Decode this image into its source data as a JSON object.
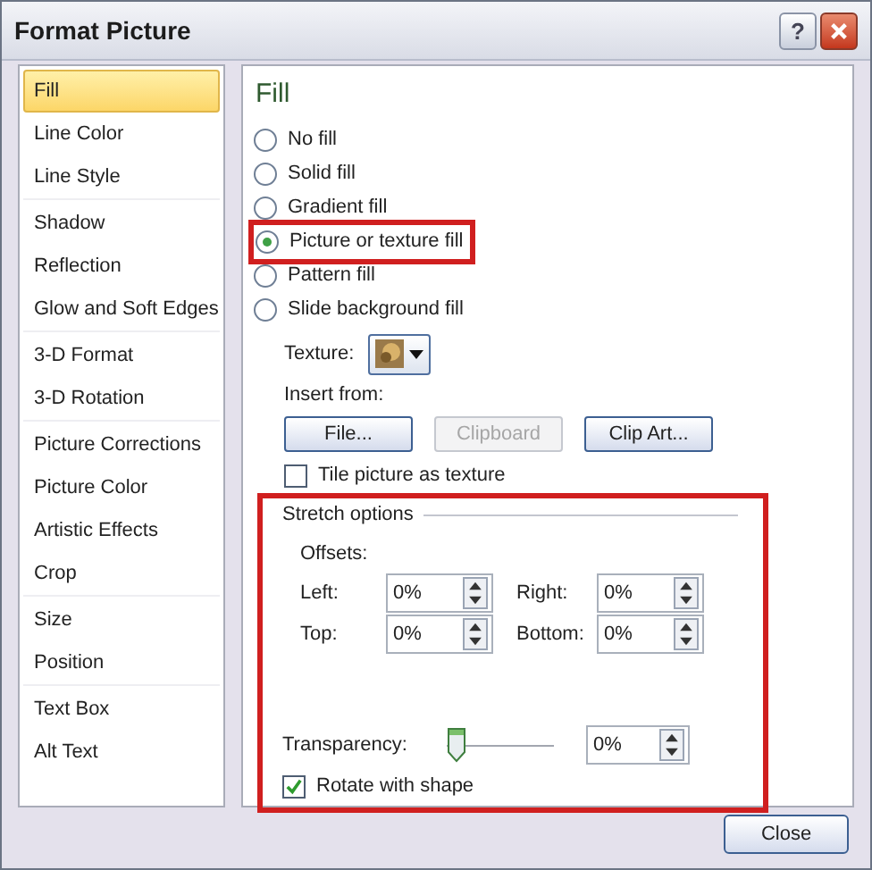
{
  "window": {
    "title": "Format Picture",
    "help": "?"
  },
  "sidebar": {
    "groups": [
      {
        "items": [
          {
            "label": "Fill",
            "selected": true
          },
          {
            "label": "Line Color",
            "selected": false
          },
          {
            "label": "Line Style",
            "selected": false
          }
        ]
      },
      {
        "items": [
          {
            "label": "Shadow",
            "selected": false
          },
          {
            "label": "Reflection",
            "selected": false
          },
          {
            "label": "Glow and Soft Edges",
            "selected": false
          }
        ]
      },
      {
        "items": [
          {
            "label": "3-D Format",
            "selected": false
          },
          {
            "label": "3-D Rotation",
            "selected": false
          }
        ]
      },
      {
        "items": [
          {
            "label": "Picture Corrections",
            "selected": false
          },
          {
            "label": "Picture Color",
            "selected": false
          },
          {
            "label": "Artistic Effects",
            "selected": false
          },
          {
            "label": "Crop",
            "selected": false
          }
        ]
      },
      {
        "items": [
          {
            "label": "Size",
            "selected": false
          },
          {
            "label": "Position",
            "selected": false
          }
        ]
      },
      {
        "items": [
          {
            "label": "Text Box",
            "selected": false
          },
          {
            "label": "Alt Text",
            "selected": false
          }
        ]
      }
    ]
  },
  "content": {
    "heading": "Fill",
    "fill_options": [
      {
        "label": "No fill",
        "selected": false,
        "highlighted": false
      },
      {
        "label": "Solid fill",
        "selected": false,
        "highlighted": false
      },
      {
        "label": "Gradient fill",
        "selected": false,
        "highlighted": false
      },
      {
        "label": "Picture or texture fill",
        "selected": true,
        "highlighted": true
      },
      {
        "label": "Pattern fill",
        "selected": false,
        "highlighted": false
      },
      {
        "label": "Slide background fill",
        "selected": false,
        "highlighted": false
      }
    ],
    "texture_label": "Texture:",
    "insert_from_label": "Insert from:",
    "insert_buttons": [
      {
        "label": "File...",
        "disabled": false
      },
      {
        "label": "Clipboard",
        "disabled": true
      },
      {
        "label": "Clip Art...",
        "disabled": false
      }
    ],
    "tile": {
      "label": "Tile picture as texture",
      "checked": false
    },
    "stretch_options": {
      "title": "Stretch options",
      "offsets_label": "Offsets:",
      "offsets": [
        {
          "label": "Left:",
          "value": "0%"
        },
        {
          "label": "Right:",
          "value": "0%"
        },
        {
          "label": "Top:",
          "value": "0%"
        },
        {
          "label": "Bottom:",
          "value": "0%"
        }
      ]
    },
    "transparency": {
      "label": "Transparency:",
      "level": 0,
      "value": "0%"
    },
    "rotate": {
      "label": "Rotate with shape",
      "checked": true
    }
  },
  "close_button": "Close"
}
